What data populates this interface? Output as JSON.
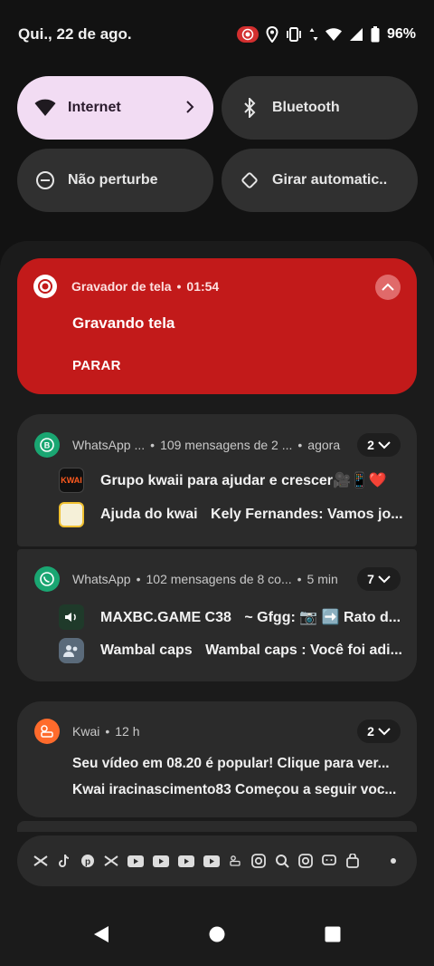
{
  "status_bar": {
    "date": "Qui., 22 de ago.",
    "battery": "96%"
  },
  "quick_settings": [
    {
      "label": "Internet",
      "icon": "wifi-icon",
      "active": true
    },
    {
      "label": "Bluetooth",
      "icon": "bluetooth-icon",
      "active": false
    },
    {
      "label": "Não perturbe",
      "icon": "do-not-disturb-icon",
      "active": false
    },
    {
      "label": "Girar automatic..",
      "icon": "auto-rotate-icon",
      "active": false
    }
  ],
  "recorder": {
    "app": "Gravador de tela",
    "time": "01:54",
    "title": "Gravando tela",
    "action": "PARAR"
  },
  "whatsapp_business": {
    "app": "WhatsApp ...",
    "summary": "109 mensagens de 2 ...",
    "time": "agora",
    "count": "2",
    "messages": [
      {
        "sender": "",
        "text": "Grupo kwaii para ajudar e crescer🎥📱❤️"
      },
      {
        "sender": "Ajuda do kwai",
        "text": "Kely Fernandes: Vamos jo..."
      }
    ]
  },
  "whatsapp": {
    "app": "WhatsApp",
    "summary": "102 mensagens de 8 co...",
    "time": "5 min",
    "count": "7",
    "messages": [
      {
        "sender": "MAXBC.GAME C38",
        "text": "~ Gfgg: 📷 ➡️ Rato d..."
      },
      {
        "sender": "Wambal caps",
        "text": "Wambal caps : Você foi adi..."
      }
    ]
  },
  "kwai": {
    "app": "Kwai",
    "time": "12 h",
    "count": "2",
    "lines": [
      "Seu vídeo em 08.20 é popular! Clique para ver...",
      "Kwai iracinascimento83 Começou a seguir voc..."
    ]
  },
  "colors": {
    "recorder_red": "#c21a1a",
    "whatsapp_green": "#1aa672",
    "kwai_orange": "#ff6b2c",
    "qs_active": "#f2dcf3"
  }
}
